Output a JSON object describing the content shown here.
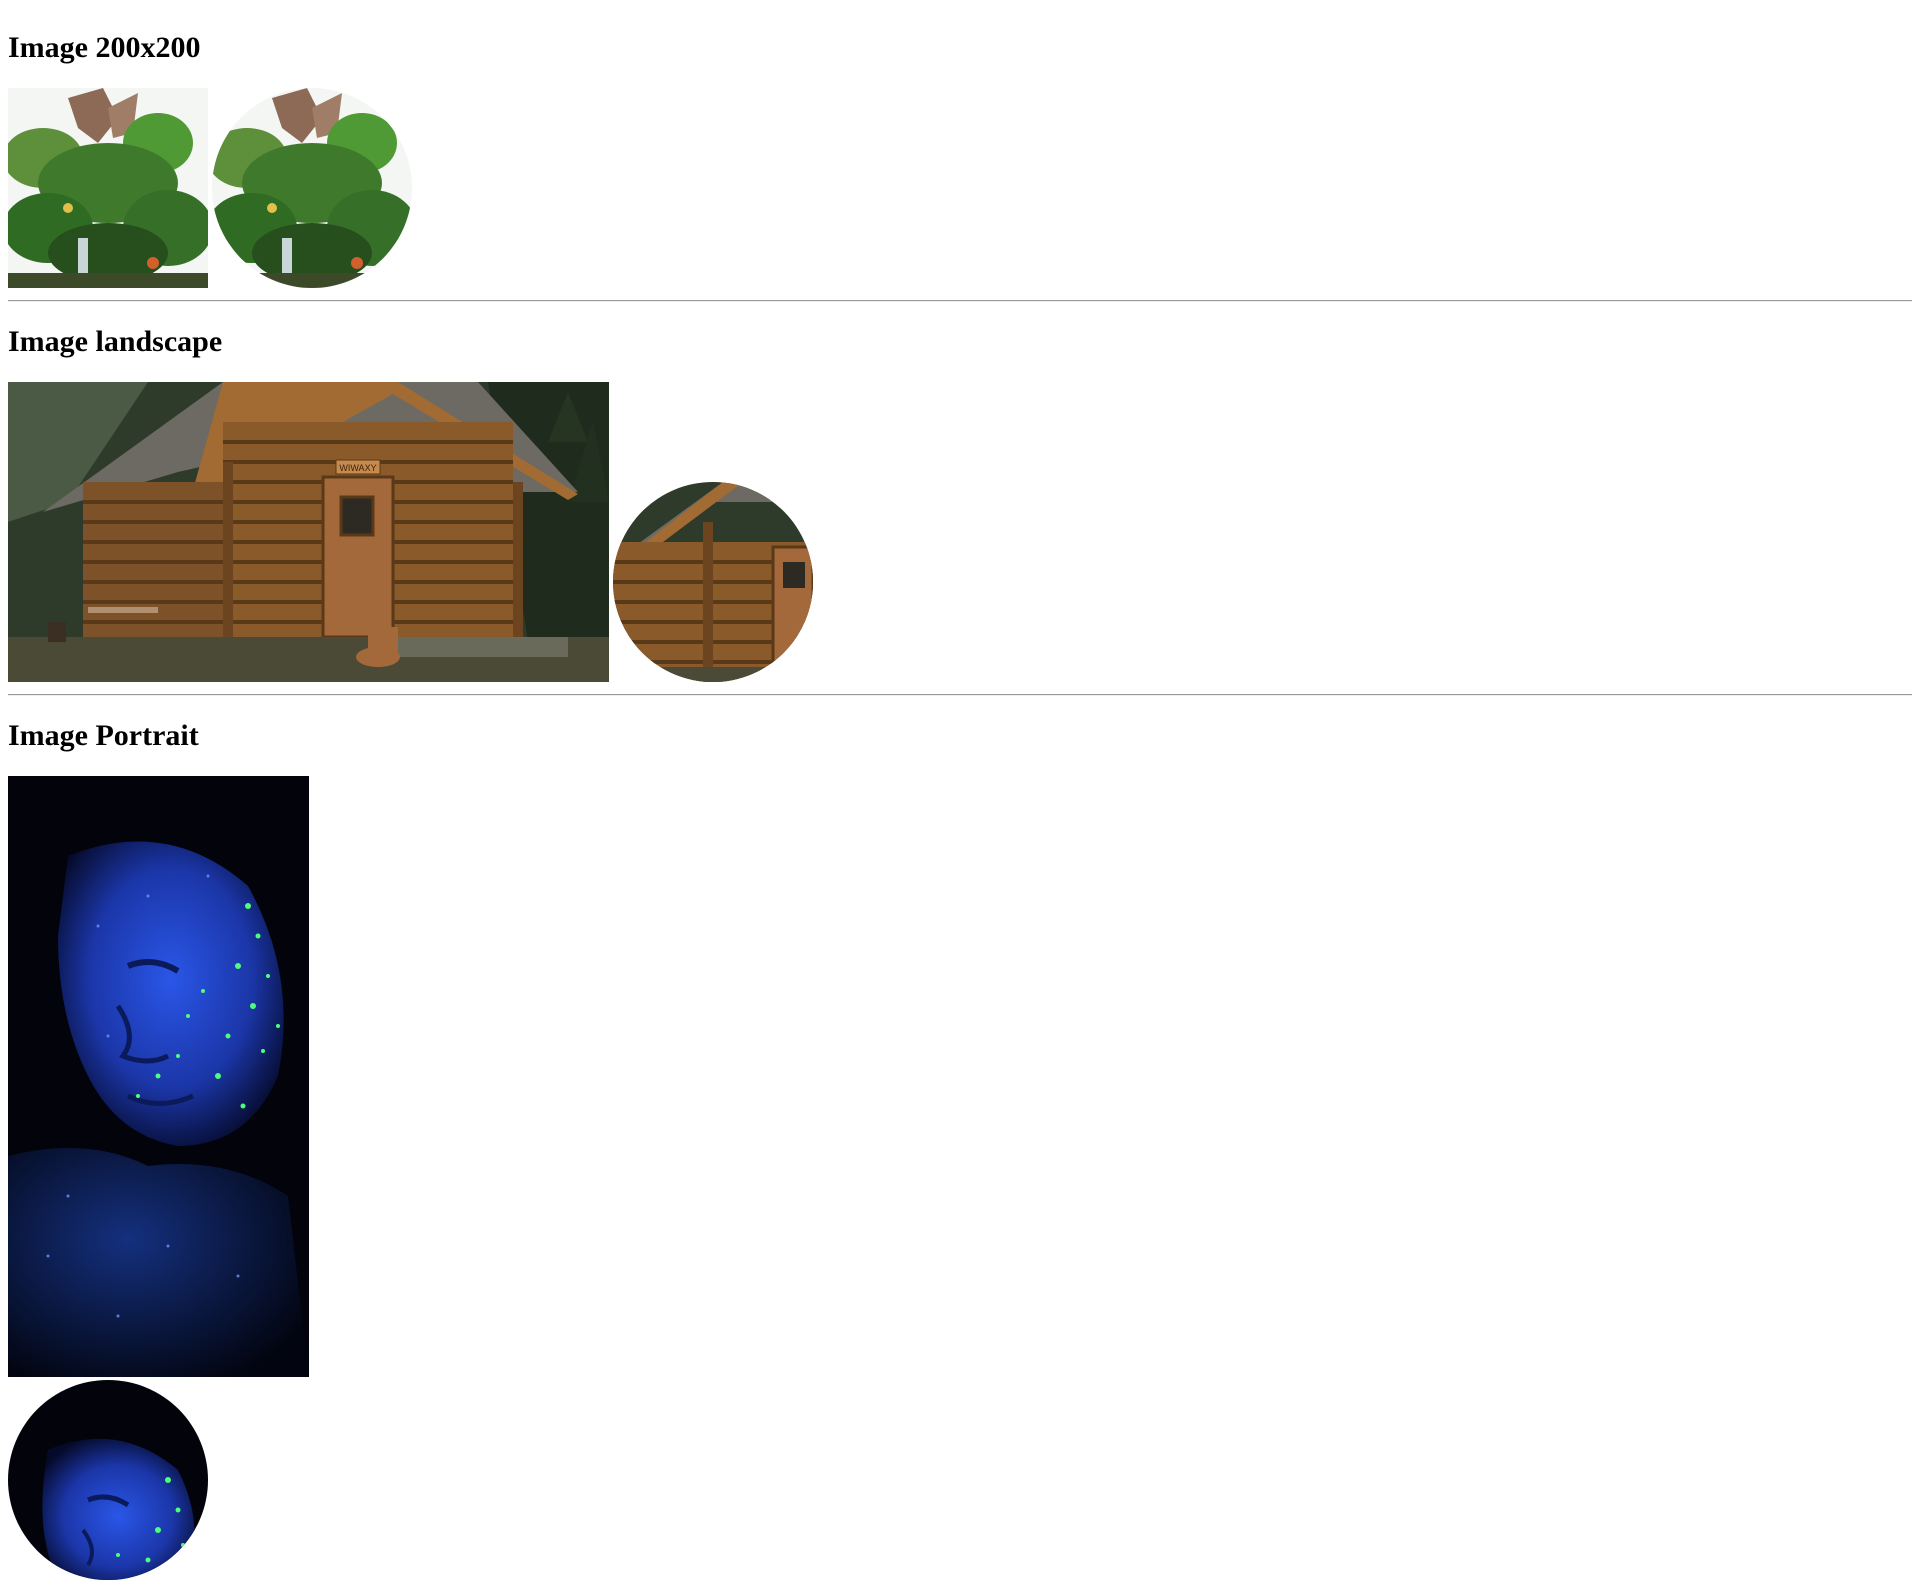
{
  "sections": [
    {
      "title": "Image 200x200"
    },
    {
      "title": "Image landscape"
    },
    {
      "title": "Image Portrait"
    }
  ],
  "images": {
    "square": {
      "subject": "jungle-tree-sculpture",
      "cabin_sign": ""
    },
    "landscape": {
      "subject": "log-cabin",
      "cabin_sign": "WIWAXY"
    },
    "portrait": {
      "subject": "glitter-face-uv"
    }
  },
  "colors": {
    "rule": "#9a9a9a",
    "foliage": "#3f7a2c",
    "wood": "#8a5a2b",
    "uv_blue": "#1d3fd0",
    "uv_green": "#4cff7a"
  }
}
